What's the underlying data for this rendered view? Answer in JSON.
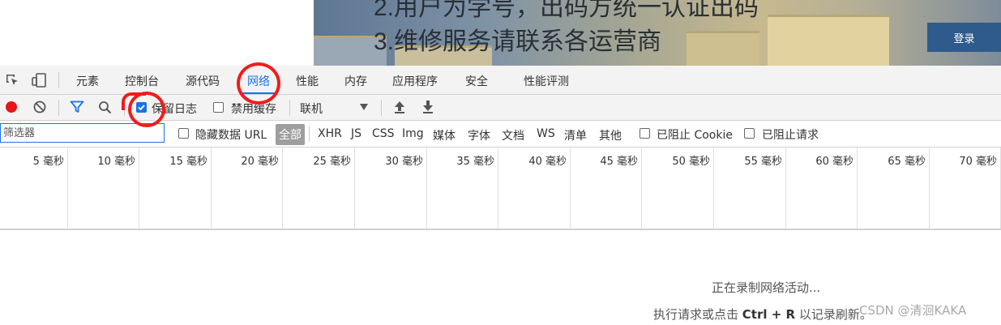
{
  "webpage": {
    "banner_line_1": "2.用户为学号，出码方统一认证出码",
    "banner_line_2": "3.维修服务请联系各运营商",
    "login_button": "登录"
  },
  "devtools": {
    "tabs": [
      {
        "label": "元素"
      },
      {
        "label": "控制台"
      },
      {
        "label": "源代码"
      },
      {
        "label": "网络",
        "active": true
      },
      {
        "label": "性能"
      },
      {
        "label": "内存"
      },
      {
        "label": "应用程序"
      },
      {
        "label": "安全"
      },
      {
        "label": "性能评测"
      }
    ],
    "toolbar": {
      "preserve_log_label": "保留日志",
      "preserve_log_checked": true,
      "disable_cache_label": "禁用缓存",
      "disable_cache_checked": false,
      "throttling_value": "联机"
    },
    "filter": {
      "placeholder": "筛选器",
      "hide_data_urls_label": "隐藏数据 URL",
      "types": [
        "全部",
        "XHR",
        "JS",
        "CSS",
        "Img",
        "媒体",
        "字体",
        "文档",
        "WS",
        "清单",
        "其他"
      ],
      "active_type": "全部",
      "blocked_cookies_label": "已阻止 Cookie",
      "blocked_requests_label": "已阻止请求"
    },
    "timeline_ticks": [
      "5 毫秒",
      "10 毫秒",
      "15 毫秒",
      "20 毫秒",
      "25 毫秒",
      "30 毫秒",
      "35 毫秒",
      "40 毫秒",
      "45 毫秒",
      "50 毫秒",
      "55 毫秒",
      "60 毫秒",
      "65 毫秒",
      "70 毫秒"
    ],
    "empty_state": {
      "recording": "正在录制网络活动...",
      "hint_prefix": "执行请求或点击",
      "hint_shortcut": "Ctrl + R",
      "hint_suffix": "以记录刷新。"
    }
  },
  "watermark": "CSDN @清洄KAKA",
  "colors": {
    "accent": "#1a73e8",
    "record_red": "#e8151a",
    "annotation_red": "#f01c1c",
    "toolbar_bg": "#f3f3f3"
  },
  "icons": [
    "inspect-icon",
    "device-toggle-icon",
    "record-icon",
    "clear-icon",
    "filter-icon",
    "search-icon",
    "dropdown-arrow-icon",
    "import-icon",
    "export-icon"
  ]
}
